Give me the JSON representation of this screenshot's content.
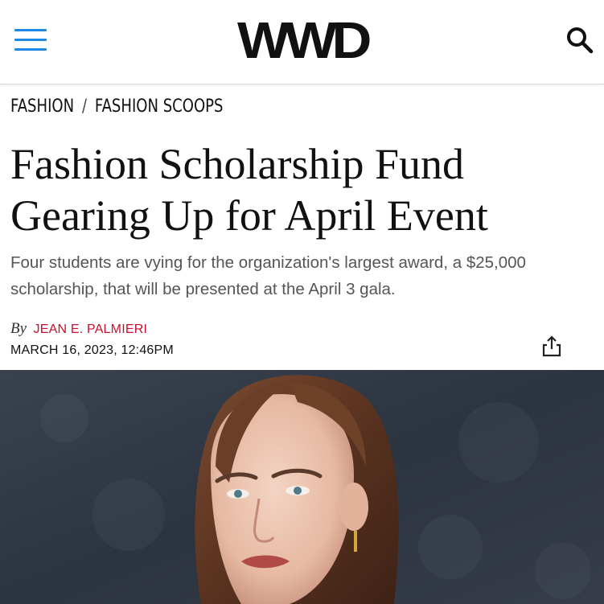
{
  "header": {
    "logo": "WWD",
    "menu_icon": "hamburger-menu-icon",
    "search_icon": "search-icon",
    "accent_color": "#1e88e5"
  },
  "breadcrumb": {
    "items": [
      "FASHION",
      "FASHION SCOOPS"
    ],
    "separator": "/"
  },
  "article": {
    "headline": "Fashion Scholarship Fund Gearing Up for April Event",
    "dek": "Four students are vying for the organization's largest award, a $25,000 scholarship, that will be presented at the April 3 gala.",
    "by_label": "By",
    "author": "JEAN E. PALMIERI",
    "author_color": "#c8102e",
    "date": "MARCH 16, 2023, 12:46PM",
    "share_icon": "share-icon"
  },
  "hero_image": {
    "description_icon": "portrait-photo"
  }
}
